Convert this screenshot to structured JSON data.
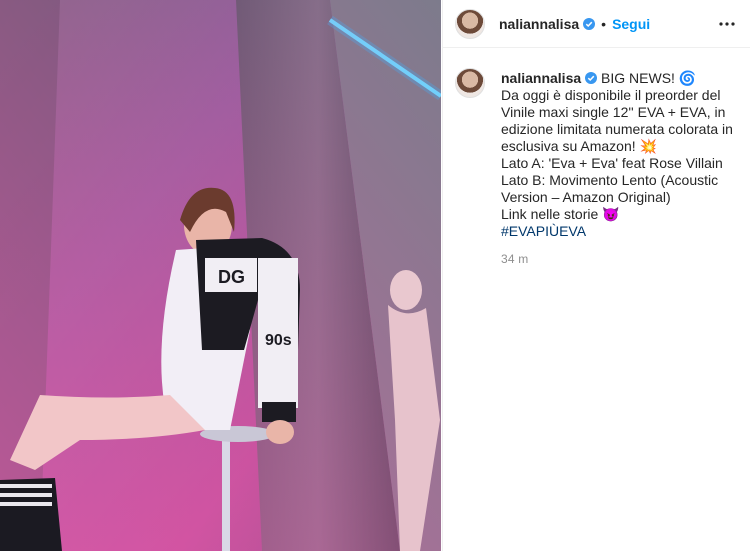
{
  "post": {
    "username": "naliannalisa",
    "follow_label": "Segui",
    "header_separator": "•",
    "caption": {
      "line1": "BIG NEWS! 🌀",
      "body": "Da oggi è disponibile il preorder del Vinile maxi single 12'' EVA + EVA, in edizione limitata numerata colorata in esclusiva su Amazon! 💥\nLato A: 'Eva + Eva' feat Rose Villain\nLato B: Movimento Lento (Acoustic Version – Amazon Original)\nLink nelle storie 😈",
      "hashtag": "#EVAPIÙEVA"
    },
    "timestamp": "34 m"
  },
  "colors": {
    "link_blue": "#0095f6",
    "hashtag_blue": "#00376b",
    "verified_blue": "#3897f0",
    "muted": "#8e8e8e"
  },
  "icons": {
    "verified": "verified-badge-icon",
    "more": "more-options-icon"
  }
}
